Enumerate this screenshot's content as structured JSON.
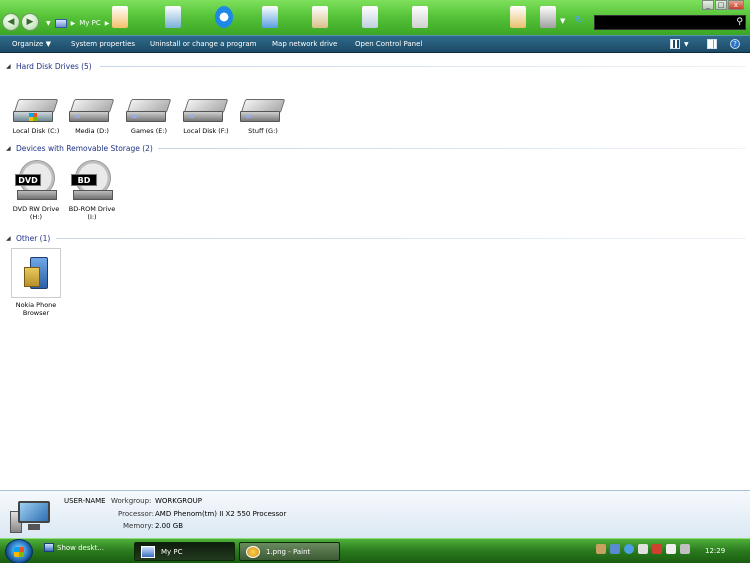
{
  "window": {
    "address_path": [
      "My PC"
    ],
    "search_placeholder": ""
  },
  "command_bar": {
    "items": [
      {
        "label": "Organize",
        "has_dropdown": true
      },
      {
        "label": "System properties"
      },
      {
        "label": "Uninstall or change a program"
      },
      {
        "label": "Map network drive"
      },
      {
        "label": "Open Control Panel"
      }
    ]
  },
  "groups": {
    "hard_disks": {
      "header": "Hard Disk Drives (5)",
      "items": [
        {
          "label": "Local Disk (C:)",
          "icon": "system-drive-icon"
        },
        {
          "label": "Media (D:)",
          "icon": "hard-drive-icon"
        },
        {
          "label": "Games (E:)",
          "icon": "hard-drive-icon"
        },
        {
          "label": "Local Disk (F:)",
          "icon": "hard-drive-icon"
        },
        {
          "label": "Stuff (G:)",
          "icon": "hard-drive-icon"
        }
      ]
    },
    "removable": {
      "header": "Devices with Removable Storage (2)",
      "items": [
        {
          "label": "DVD RW Drive",
          "label2": "(H:)",
          "badge": "DVD"
        },
        {
          "label": "BD-ROM Drive",
          "label2": "(I:)",
          "badge": "BD"
        }
      ]
    },
    "other": {
      "header": "Other (1)",
      "items": [
        {
          "label": "Nokia Phone",
          "label2": "Browser"
        }
      ]
    }
  },
  "details": {
    "computer_name": "USER-NAME",
    "workgroup_label": "Workgroup:",
    "workgroup_value": "WORKGROUP",
    "processor_label": "Processor:",
    "processor_value": "AMD Phenom(tm) II X2 550 Processor",
    "memory_label": "Memory:",
    "memory_value": "2.00 GB"
  },
  "taskbar": {
    "quick_launch": "Show deskt...",
    "tasks": [
      {
        "label": "My PC",
        "active": true
      },
      {
        "label": "1.png - Paint",
        "active": false
      }
    ],
    "clock": "12:29"
  },
  "colors": {
    "title_green": "#58c43a",
    "command_bar": "#1c4a66",
    "group_header": "#1e3287",
    "taskbar_green": "#2a7a1e"
  }
}
